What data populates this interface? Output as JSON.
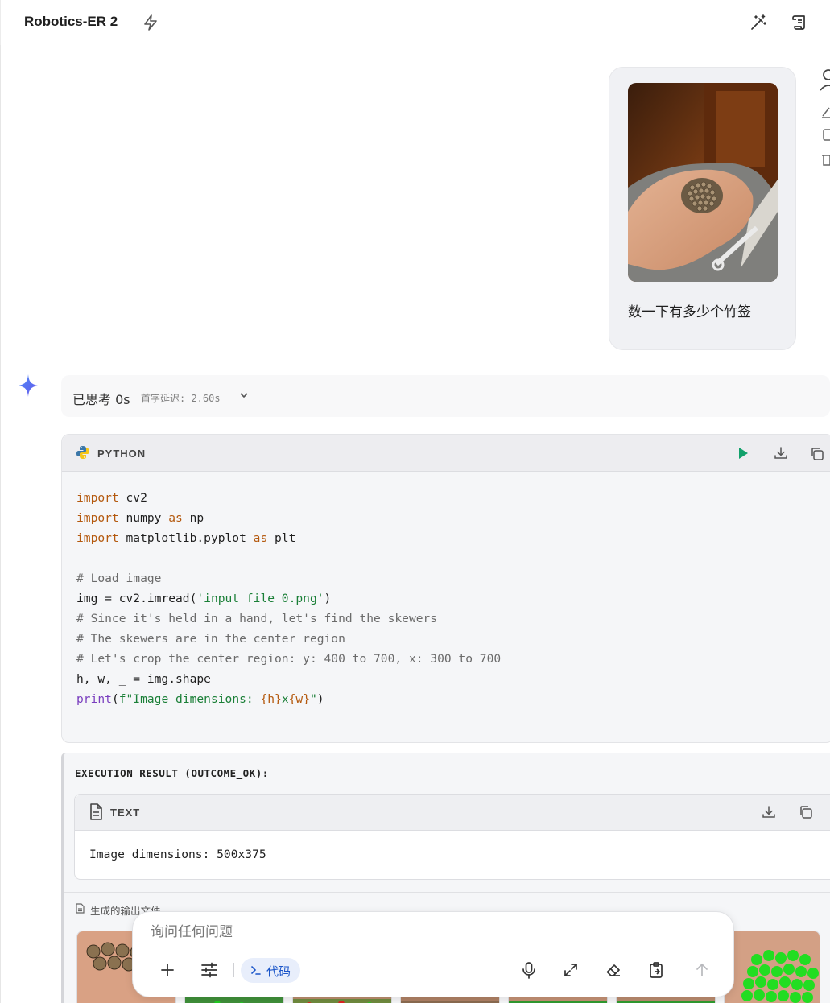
{
  "header": {
    "app_title": "Robotics-ER 2",
    "icons": [
      "bolt-icon",
      "magic-wand-icon",
      "scroll-icon"
    ]
  },
  "user_message": {
    "text": "数一下有多少个竹签",
    "image_alt": "hand holding bamboo skewers"
  },
  "assistant": {
    "thought_label": "已思考 0s",
    "latency": "首字延迟: 2.60s",
    "code": {
      "language": "PYTHON",
      "lines": [
        "import cv2",
        "import numpy as np",
        "import matplotlib.pyplot as plt",
        "",
        "# Load image",
        "img = cv2.imread('input_file_0.png')",
        "# Since it's held in a hand, let's find the skewers",
        "# The skewers are in the center region",
        "# Let's crop the center region: y: 400 to 700, x: 300 to 700",
        "h, w, _ = img.shape",
        "print(f\"Image dimensions: {h}x{w}\")"
      ]
    },
    "result": {
      "title": "EXECUTION RESULT (OUTCOME_OK):",
      "text_label": "TEXT",
      "output": "Image dimensions: 500x375",
      "files_label": "生成的输出文件"
    }
  },
  "input": {
    "placeholder": "询问任何问题",
    "value": "",
    "code_chip_label": "代码"
  },
  "colors": {
    "run_green": "#12a16b",
    "chip_blue": "#1a55c9",
    "keyword": "#b4590e",
    "string": "#1a7f37"
  }
}
